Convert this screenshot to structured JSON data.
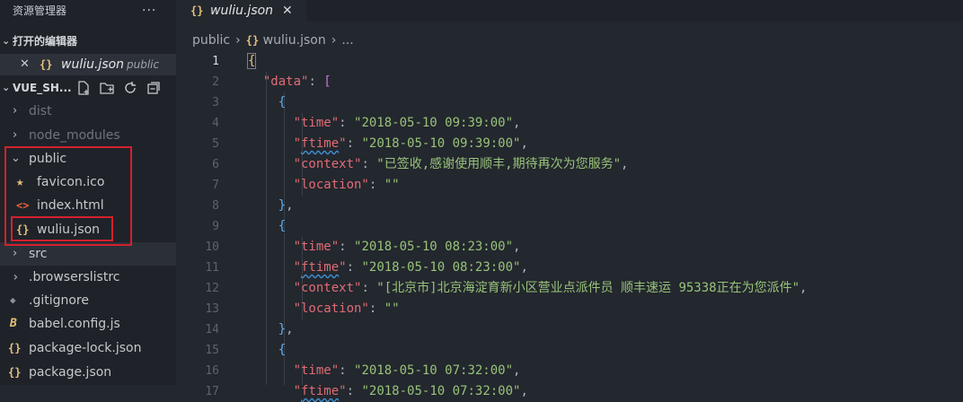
{
  "sidebar": {
    "title": "资源管理器",
    "more": "···",
    "open_editors": {
      "label": "打开的编辑器",
      "items": [
        {
          "close": "✕",
          "icon": "{}",
          "name": "wuliu.json",
          "path": "public"
        }
      ]
    },
    "project": {
      "label": "VUE_SH...",
      "tree": [
        {
          "name": "dist",
          "type": "folder"
        },
        {
          "name": "node_modules",
          "type": "folder"
        },
        {
          "name": "public",
          "type": "folder-open"
        },
        {
          "name": "favicon.ico",
          "icon": "★"
        },
        {
          "name": "index.html",
          "icon": "<>"
        },
        {
          "name": "wuliu.json",
          "icon": "{}"
        },
        {
          "name": "src",
          "type": "folder"
        },
        {
          "name": ".browserslistrc",
          "icon": "›"
        },
        {
          "name": ".gitignore",
          "icon": "◆"
        },
        {
          "name": "babel.config.js",
          "icon": "B"
        },
        {
          "name": "package-lock.json",
          "icon": "{}"
        },
        {
          "name": "package.json",
          "icon": "{}"
        }
      ]
    }
  },
  "tab": {
    "icon": "{}",
    "name": "wuliu.json",
    "close": "✕"
  },
  "breadcrumb": {
    "folder": "public",
    "icon": "{}",
    "file": "wuliu.json",
    "tail": "..."
  },
  "editor": {
    "line_numbers": [
      "1",
      "2",
      "3",
      "4",
      "5",
      "6",
      "7",
      "8",
      "9",
      "10",
      "11",
      "12",
      "13",
      "14",
      "15",
      "16",
      "17"
    ],
    "current_line": "1",
    "lines": [
      "{",
      "  \"data\": [",
      "    {",
      "      \"time\": \"2018-05-10 09:39:00\",",
      "      \"ftime\": \"2018-05-10 09:39:00\",",
      "      \"context\": \"已签收,感谢使用顺丰,期待再次为您服务\",",
      "      \"location\": \"\"",
      "    },",
      "    {",
      "      \"time\": \"2018-05-10 08:23:00\",",
      "      \"ftime\": \"2018-05-10 08:23:00\",",
      "      \"context\": \"[北京市]北京海淀育新小区营业点派件员 顺丰速运 95338正在为您派件\",",
      "      \"location\": \"\"",
      "    },",
      "    {",
      "      \"time\": \"2018-05-10 07:32:00\",",
      "      \"ftime\": \"2018-05-10 07:32:00\","
    ]
  },
  "colors": {
    "accent_brace": "#e5c07b",
    "key": "#e06c75",
    "string": "#98c379",
    "highlight_box": "#d3212d"
  }
}
